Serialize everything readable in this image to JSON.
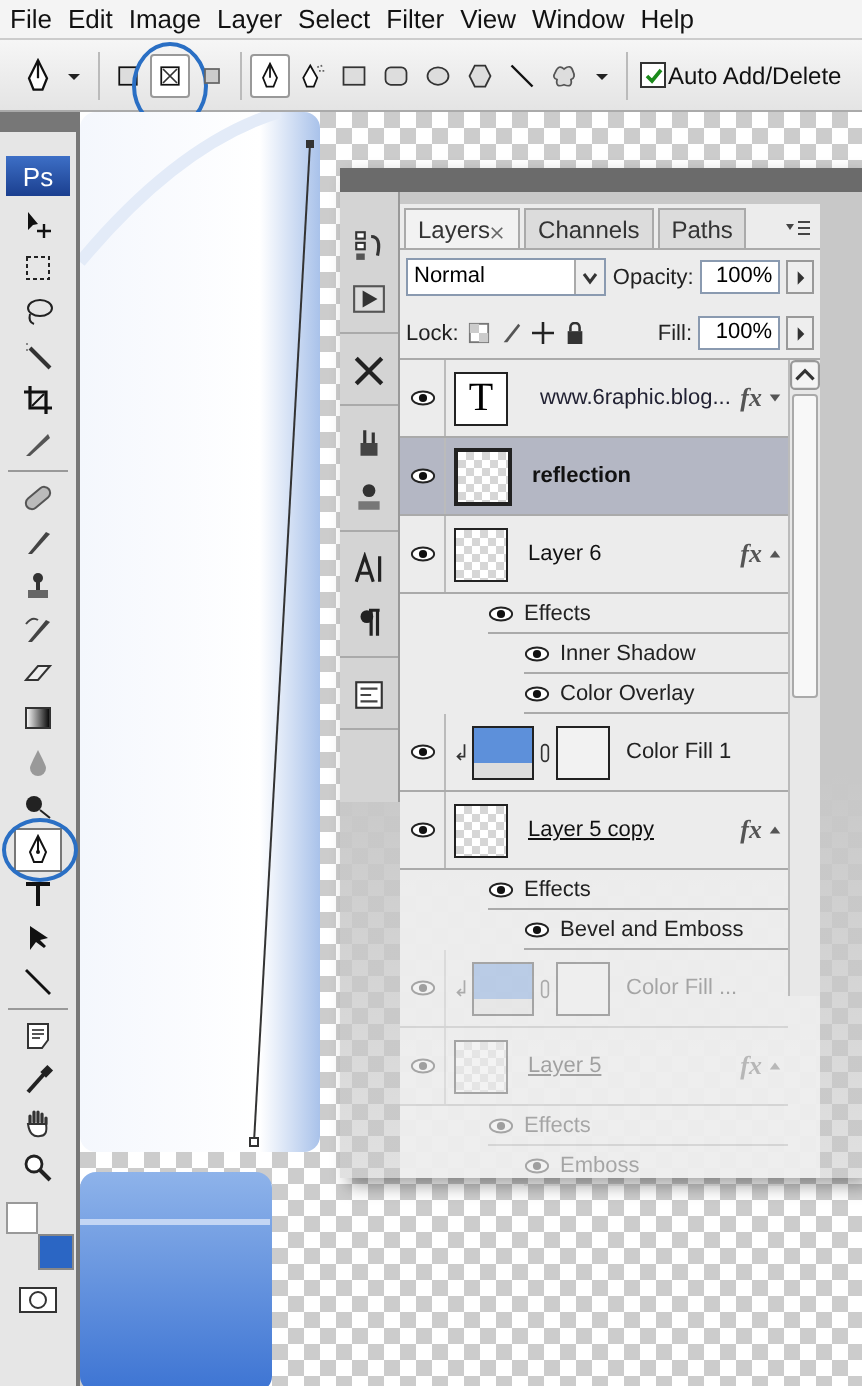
{
  "menu": [
    "File",
    "Edit",
    "Image",
    "Layer",
    "Select",
    "Filter",
    "View",
    "Window",
    "Help"
  ],
  "options_bar": {
    "path_modes": [
      {
        "selected": false,
        "highlighted": false
      },
      {
        "selected": true,
        "highlighted": true
      },
      {
        "selected": false,
        "highlighted": false
      }
    ],
    "draw_tools": [
      {
        "selected": true
      },
      {
        "selected": false
      },
      {
        "selected": false
      },
      {
        "selected": false
      },
      {
        "selected": false
      },
      {
        "selected": false
      },
      {
        "selected": false
      },
      {
        "selected": false
      }
    ],
    "auto_add_delete": {
      "label": "Auto Add/Delete",
      "checked": true
    }
  },
  "toolbox": {
    "logo": "Ps",
    "tools": [
      {
        "selected": false,
        "highlighted": false
      },
      {
        "selected": false,
        "highlighted": false
      },
      {
        "selected": false,
        "highlighted": false
      },
      {
        "selected": false,
        "highlighted": false
      },
      {
        "selected": false,
        "highlighted": false
      },
      {
        "selected": false,
        "highlighted": false
      },
      {
        "selected": false,
        "highlighted": false
      },
      {
        "selected": false,
        "highlighted": false
      },
      {
        "selected": false,
        "highlighted": false
      },
      {
        "selected": false,
        "highlighted": false
      },
      {
        "selected": false,
        "highlighted": false
      },
      {
        "selected": false,
        "highlighted": false
      },
      {
        "selected": false,
        "highlighted": false
      },
      {
        "selected": false,
        "highlighted": false
      },
      {
        "selected": true,
        "highlighted": true
      },
      {
        "selected": false,
        "highlighted": false
      },
      {
        "selected": false,
        "highlighted": false
      },
      {
        "selected": false,
        "highlighted": false
      },
      {
        "selected": false,
        "highlighted": false
      },
      {
        "selected": false,
        "highlighted": false
      },
      {
        "selected": false,
        "highlighted": false
      },
      {
        "selected": false,
        "highlighted": false
      }
    ]
  },
  "layers_panel": {
    "tabs": [
      {
        "label": "Layers",
        "selected": true
      },
      {
        "label": "Channels",
        "selected": false
      },
      {
        "label": "Paths",
        "selected": false
      }
    ],
    "blend_mode": "Normal",
    "opacity_label": "Opacity:",
    "opacity": "100%",
    "lock_label": "Lock:",
    "fill_label": "Fill:",
    "fill": "100%",
    "layers": [
      {
        "kind": "text",
        "name": "www.6raphic.blog...",
        "thumb": "T",
        "fx": "fx",
        "visible": true,
        "selected": false,
        "ghost": false,
        "underlined": false
      },
      {
        "kind": "pixel",
        "name": "reflection",
        "visible": true,
        "selected": true,
        "ghost": false,
        "underlined": false
      },
      {
        "kind": "pixel",
        "name": "Layer 6",
        "fx": "fx",
        "visible": true,
        "selected": false,
        "ghost": false,
        "underlined": false,
        "effects_label": "Effects",
        "effects": [
          "Inner Shadow",
          "Color Overlay"
        ]
      },
      {
        "kind": "fill",
        "name": "Color Fill 1",
        "visible": true,
        "selected": false,
        "ghost": false,
        "underlined": false
      },
      {
        "kind": "pixel",
        "name": "Layer 5 copy",
        "fx": "fx",
        "visible": true,
        "selected": false,
        "ghost": false,
        "underlined": true,
        "effects_label": "Effects",
        "effects": [
          "Bevel and Emboss"
        ]
      },
      {
        "kind": "fill",
        "name": "Color Fill ...",
        "visible": true,
        "selected": false,
        "ghost": true,
        "underlined": false
      },
      {
        "kind": "pixel",
        "name": "Layer 5",
        "fx": "fx",
        "visible": true,
        "selected": false,
        "ghost": true,
        "underlined": true,
        "effects_label": "Effects",
        "effects": [
          "Emboss"
        ]
      }
    ]
  }
}
